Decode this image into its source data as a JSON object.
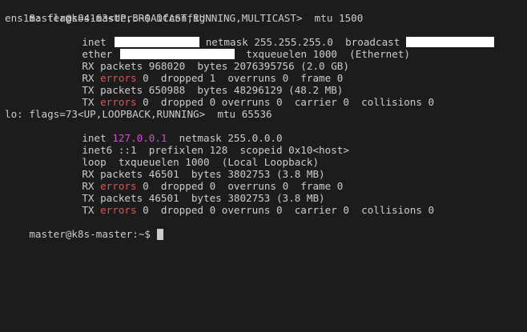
{
  "prompt": "master@k8s-master:~$",
  "command": " ifconfig",
  "ens18": {
    "header": "ens18: flags=4163<UP,BROADCAST,RUNNING,MULTICAST>  mtu 1500",
    "inet_label": "inet",
    "netmask_text": "netmask 255.255.255.0  broadcast",
    "ether_label": "ether",
    "txqueuelen_text": "txqueuelen 1000  (Ethernet)",
    "rx_packets": "RX packets 968020  bytes 2076395756 (2.0 GB)",
    "rx_prefix": "RX ",
    "errors_word": "errors",
    "rx_errors_rest": " 0  dropped 1  overruns 0  frame 0",
    "tx_packets": "TX packets 650988  bytes 48296129 (48.2 MB)",
    "tx_prefix": "TX ",
    "tx_errors_rest": " 0  dropped 0 overruns 0  carrier 0  collisions 0"
  },
  "lo": {
    "header": "lo: flags=73<UP,LOOPBACK,RUNNING>  mtu 65536",
    "inet_label": "inet ",
    "inet_addr": "127.0.0.1",
    "netmask_text": "  netmask 255.0.0.0",
    "inet6_text": "inet6 ::1  prefixlen 128  scopeid 0x10<host>",
    "loop_text": "loop  txqueuelen 1000  (Local Loopback)",
    "rx_packets": "RX packets 46501  bytes 3802753 (3.8 MB)",
    "rx_prefix": "RX ",
    "errors_word": "errors",
    "rx_errors_rest": " 0  dropped 0  overruns 0  frame 0",
    "tx_packets": "TX packets 46501  bytes 3802753 (3.8 MB)",
    "tx_prefix": "TX ",
    "tx_errors_rest": " 0  dropped 0 overruns 0  carrier 0  collisions 0"
  },
  "final_prompt": "master@k8s-master:~$ ",
  "colors": {
    "background": "#1c1c1c",
    "text": "#cccccc",
    "errors": "#e05252",
    "loopback_addr": "#d24fd0"
  }
}
